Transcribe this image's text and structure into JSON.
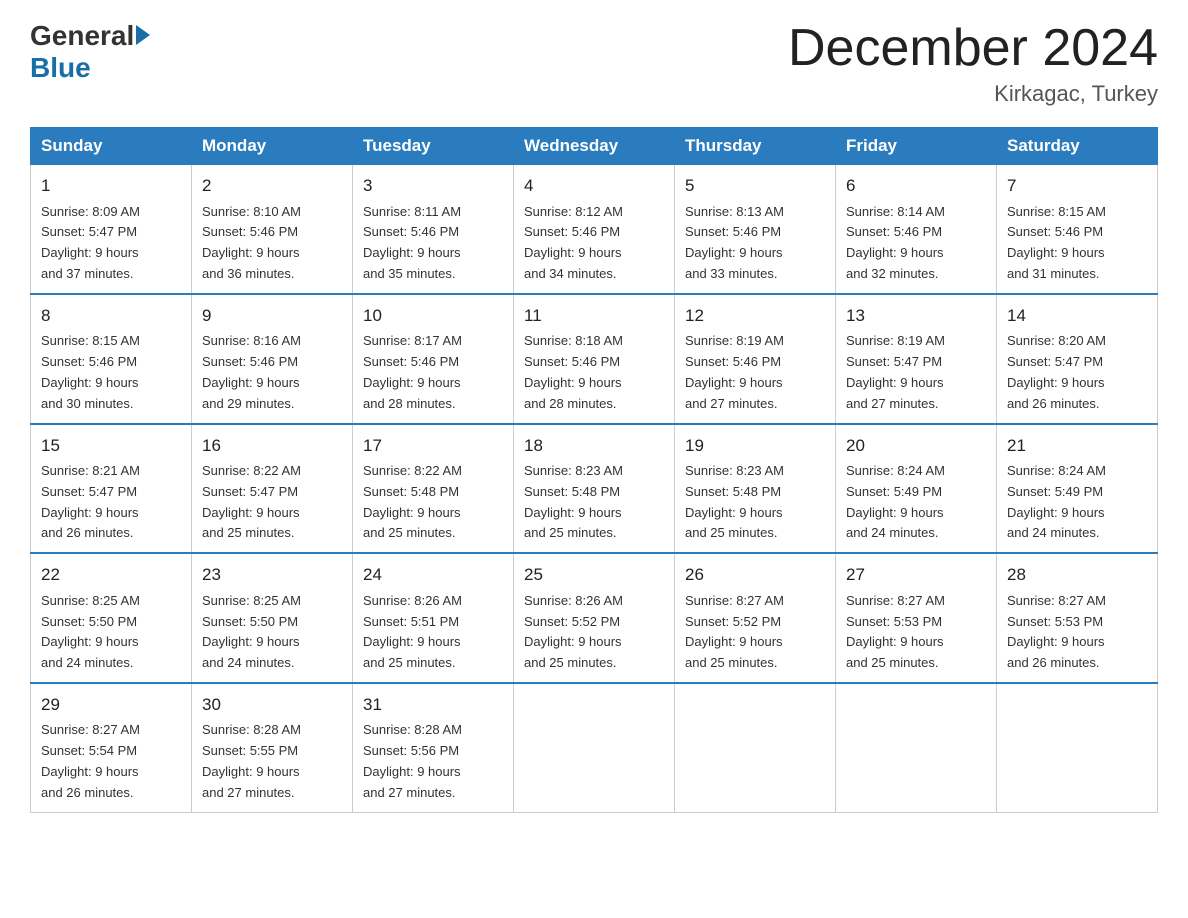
{
  "logo": {
    "general": "General",
    "blue": "Blue"
  },
  "title": "December 2024",
  "location": "Kirkagac, Turkey",
  "days_header": [
    "Sunday",
    "Monday",
    "Tuesday",
    "Wednesday",
    "Thursday",
    "Friday",
    "Saturday"
  ],
  "weeks": [
    [
      {
        "day": "1",
        "sunrise": "8:09 AM",
        "sunset": "5:47 PM",
        "daylight": "9 hours and 37 minutes."
      },
      {
        "day": "2",
        "sunrise": "8:10 AM",
        "sunset": "5:46 PM",
        "daylight": "9 hours and 36 minutes."
      },
      {
        "day": "3",
        "sunrise": "8:11 AM",
        "sunset": "5:46 PM",
        "daylight": "9 hours and 35 minutes."
      },
      {
        "day": "4",
        "sunrise": "8:12 AM",
        "sunset": "5:46 PM",
        "daylight": "9 hours and 34 minutes."
      },
      {
        "day": "5",
        "sunrise": "8:13 AM",
        "sunset": "5:46 PM",
        "daylight": "9 hours and 33 minutes."
      },
      {
        "day": "6",
        "sunrise": "8:14 AM",
        "sunset": "5:46 PM",
        "daylight": "9 hours and 32 minutes."
      },
      {
        "day": "7",
        "sunrise": "8:15 AM",
        "sunset": "5:46 PM",
        "daylight": "9 hours and 31 minutes."
      }
    ],
    [
      {
        "day": "8",
        "sunrise": "8:15 AM",
        "sunset": "5:46 PM",
        "daylight": "9 hours and 30 minutes."
      },
      {
        "day": "9",
        "sunrise": "8:16 AM",
        "sunset": "5:46 PM",
        "daylight": "9 hours and 29 minutes."
      },
      {
        "day": "10",
        "sunrise": "8:17 AM",
        "sunset": "5:46 PM",
        "daylight": "9 hours and 28 minutes."
      },
      {
        "day": "11",
        "sunrise": "8:18 AM",
        "sunset": "5:46 PM",
        "daylight": "9 hours and 28 minutes."
      },
      {
        "day": "12",
        "sunrise": "8:19 AM",
        "sunset": "5:46 PM",
        "daylight": "9 hours and 27 minutes."
      },
      {
        "day": "13",
        "sunrise": "8:19 AM",
        "sunset": "5:47 PM",
        "daylight": "9 hours and 27 minutes."
      },
      {
        "day": "14",
        "sunrise": "8:20 AM",
        "sunset": "5:47 PM",
        "daylight": "9 hours and 26 minutes."
      }
    ],
    [
      {
        "day": "15",
        "sunrise": "8:21 AM",
        "sunset": "5:47 PM",
        "daylight": "9 hours and 26 minutes."
      },
      {
        "day": "16",
        "sunrise": "8:22 AM",
        "sunset": "5:47 PM",
        "daylight": "9 hours and 25 minutes."
      },
      {
        "day": "17",
        "sunrise": "8:22 AM",
        "sunset": "5:48 PM",
        "daylight": "9 hours and 25 minutes."
      },
      {
        "day": "18",
        "sunrise": "8:23 AM",
        "sunset": "5:48 PM",
        "daylight": "9 hours and 25 minutes."
      },
      {
        "day": "19",
        "sunrise": "8:23 AM",
        "sunset": "5:48 PM",
        "daylight": "9 hours and 25 minutes."
      },
      {
        "day": "20",
        "sunrise": "8:24 AM",
        "sunset": "5:49 PM",
        "daylight": "9 hours and 24 minutes."
      },
      {
        "day": "21",
        "sunrise": "8:24 AM",
        "sunset": "5:49 PM",
        "daylight": "9 hours and 24 minutes."
      }
    ],
    [
      {
        "day": "22",
        "sunrise": "8:25 AM",
        "sunset": "5:50 PM",
        "daylight": "9 hours and 24 minutes."
      },
      {
        "day": "23",
        "sunrise": "8:25 AM",
        "sunset": "5:50 PM",
        "daylight": "9 hours and 24 minutes."
      },
      {
        "day": "24",
        "sunrise": "8:26 AM",
        "sunset": "5:51 PM",
        "daylight": "9 hours and 25 minutes."
      },
      {
        "day": "25",
        "sunrise": "8:26 AM",
        "sunset": "5:52 PM",
        "daylight": "9 hours and 25 minutes."
      },
      {
        "day": "26",
        "sunrise": "8:27 AM",
        "sunset": "5:52 PM",
        "daylight": "9 hours and 25 minutes."
      },
      {
        "day": "27",
        "sunrise": "8:27 AM",
        "sunset": "5:53 PM",
        "daylight": "9 hours and 25 minutes."
      },
      {
        "day": "28",
        "sunrise": "8:27 AM",
        "sunset": "5:53 PM",
        "daylight": "9 hours and 26 minutes."
      }
    ],
    [
      {
        "day": "29",
        "sunrise": "8:27 AM",
        "sunset": "5:54 PM",
        "daylight": "9 hours and 26 minutes."
      },
      {
        "day": "30",
        "sunrise": "8:28 AM",
        "sunset": "5:55 PM",
        "daylight": "9 hours and 27 minutes."
      },
      {
        "day": "31",
        "sunrise": "8:28 AM",
        "sunset": "5:56 PM",
        "daylight": "9 hours and 27 minutes."
      },
      null,
      null,
      null,
      null
    ]
  ],
  "labels": {
    "sunrise": "Sunrise:",
    "sunset": "Sunset:",
    "daylight": "Daylight:"
  }
}
